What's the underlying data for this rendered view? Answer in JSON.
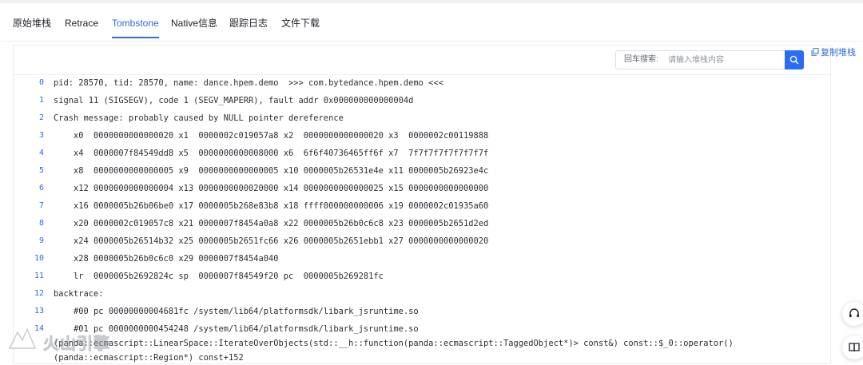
{
  "tabs": [
    {
      "label": "原始堆栈",
      "active": false
    },
    {
      "label": "Retrace",
      "active": false
    },
    {
      "label": "Tombstone",
      "active": true
    },
    {
      "label": "Native信息",
      "active": false
    },
    {
      "label": "跟踪日志",
      "active": false
    },
    {
      "label": "文件下载",
      "active": false
    }
  ],
  "toolbar": {
    "search_label": "回车搜索:",
    "search_placeholder": "请输入堆栈内容",
    "search_value": "",
    "search_icon": "search-icon",
    "copy_label": "复制堆栈",
    "copy_icon": "copy-icon"
  },
  "lines": [
    {
      "n": "0",
      "text": "pid: 28570, tid: 28570, name: dance.hpem.demo  >>> com.bytedance.hpem.demo <<<"
    },
    {
      "n": "1",
      "text": "signal 11 (SIGSEGV), code 1 (SEGV_MAPERR), fault addr 0x000000000000004d"
    },
    {
      "n": "2",
      "text": "Crash message: probably caused by NULL pointer dereference"
    },
    {
      "n": "3",
      "text": "    x0  0000000000000020 x1  0000002c019057a8 x2  0000000000000020 x3  0000002c00119888"
    },
    {
      "n": "4",
      "text": "    x4  0000007f84549dd8 x5  0000000000008000 x6  6f6f40736465ff6f x7  7f7f7f7f7f7f7f7f"
    },
    {
      "n": "5",
      "text": "    x8  0000000000000005 x9  0000000000000005 x10 0000005b26531e4e x11 0000005b26923e4c"
    },
    {
      "n": "6",
      "text": "    x12 0000000000000004 x13 0000000000020000 x14 0000000000000025 x15 0000000000000000"
    },
    {
      "n": "7",
      "text": "    x16 0000005b26b06be0 x17 0000005b268e83b8 x18 ffff000000000006 x19 0000002c01935a60"
    },
    {
      "n": "8",
      "text": "    x20 0000002c019057c8 x21 0000007f8454a0a8 x22 0000005b26b0c6c8 x23 0000005b2651d2ed"
    },
    {
      "n": "9",
      "text": "    x24 0000005b26514b32 x25 0000005b2651fc66 x26 0000005b2651ebb1 x27 0000000000000020"
    },
    {
      "n": "10",
      "text": "    x28 0000005b26b0c6c0 x29 0000007f8454a040"
    },
    {
      "n": "11",
      "text": "    lr  0000005b2692824c sp  0000007f84549f20 pc  0000005b269281fc"
    },
    {
      "n": "12",
      "text": "backtrace:"
    },
    {
      "n": "13",
      "text": "    #00 pc 00000000004681fc /system/lib64/platformsdk/libark_jsruntime.so"
    },
    {
      "n": "14",
      "text": "    #01 pc 0000000000454248 /system/lib64/platformsdk/libark_jsruntime.so (panda::ecmascript::LinearSpace::IterateOverObjects(std::__h::function(panda::ecmascript::TaggedObject*)> const&) const::$_0::operator()(panda::ecmascript::Region*) const+152"
    }
  ],
  "float_buttons": [
    {
      "icon": "feedback-icon"
    },
    {
      "icon": "book-icon"
    }
  ],
  "watermark": {
    "text": "火山引擎",
    "icon": "volcengine-logo-icon"
  },
  "colors": {
    "accent": "#2f6bdb",
    "search_button": "#2a6df4",
    "text": "#2b2f36"
  }
}
